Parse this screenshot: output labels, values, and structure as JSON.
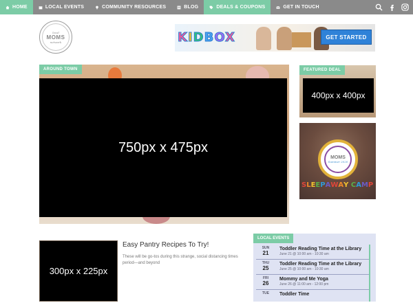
{
  "nav": {
    "items": [
      {
        "label": "HOME",
        "icon": "home-icon",
        "active": true
      },
      {
        "label": "LOCAL EVENTS",
        "icon": "calendar-icon",
        "active": false
      },
      {
        "label": "COMMUNITY RESOURCES",
        "icon": "lightbulb-icon",
        "active": false
      },
      {
        "label": "BLOG",
        "icon": "list-icon",
        "active": false
      },
      {
        "label": "DEALS & COUPONS",
        "icon": "tag-icon",
        "active": false
      },
      {
        "label": "GET IN TOUCH",
        "icon": "envelope-icon",
        "active": false
      }
    ],
    "right_icons": [
      "search-icon",
      "facebook-icon",
      "instagram-icon"
    ],
    "colors": {
      "bar": "#8a8a8a",
      "active": "#7ccca6"
    }
  },
  "logo": {
    "top": "local",
    "middle": "MOMS",
    "bottom": "network"
  },
  "ad": {
    "brand": "KIDBOX",
    "button": "GET STARTED"
  },
  "hero": {
    "tag": "AROUND TOWN",
    "placeholder": "750px x 475px"
  },
  "featured": {
    "tag": "FEATURED DEAL",
    "placeholder": "400px x 400px"
  },
  "camp_ad": {
    "ring_text": "THE ULTIMATE CAMP GUIDE",
    "moms": "MOMS",
    "year": "Summer 2020",
    "title": "SLEEPAWAY CAMP"
  },
  "post": {
    "thumb": "300px x 225px",
    "title": "Easy Pantry Recipes To Try!",
    "excerpt": "These will be go-tos during this strange, social distancing times period—and beyond"
  },
  "events": {
    "tag": "LOCAL EVENTS",
    "items": [
      {
        "dow": "SUN",
        "day": "21",
        "title": "Toddler Reading Time at the Library",
        "time": "June 21 @ 10:00 am - 10:30 am"
      },
      {
        "dow": "THU",
        "day": "25",
        "title": "Toddler Reading Time at the Library",
        "time": "June 25 @ 10:00 am - 10:30 am"
      },
      {
        "dow": "FRI",
        "day": "26",
        "title": "Mommy and Me Yoga",
        "time": "June 26 @ 11:00 am - 12:00 pm"
      },
      {
        "dow": "TUE",
        "day": "",
        "title": "Toddler Time",
        "time": ""
      }
    ]
  }
}
